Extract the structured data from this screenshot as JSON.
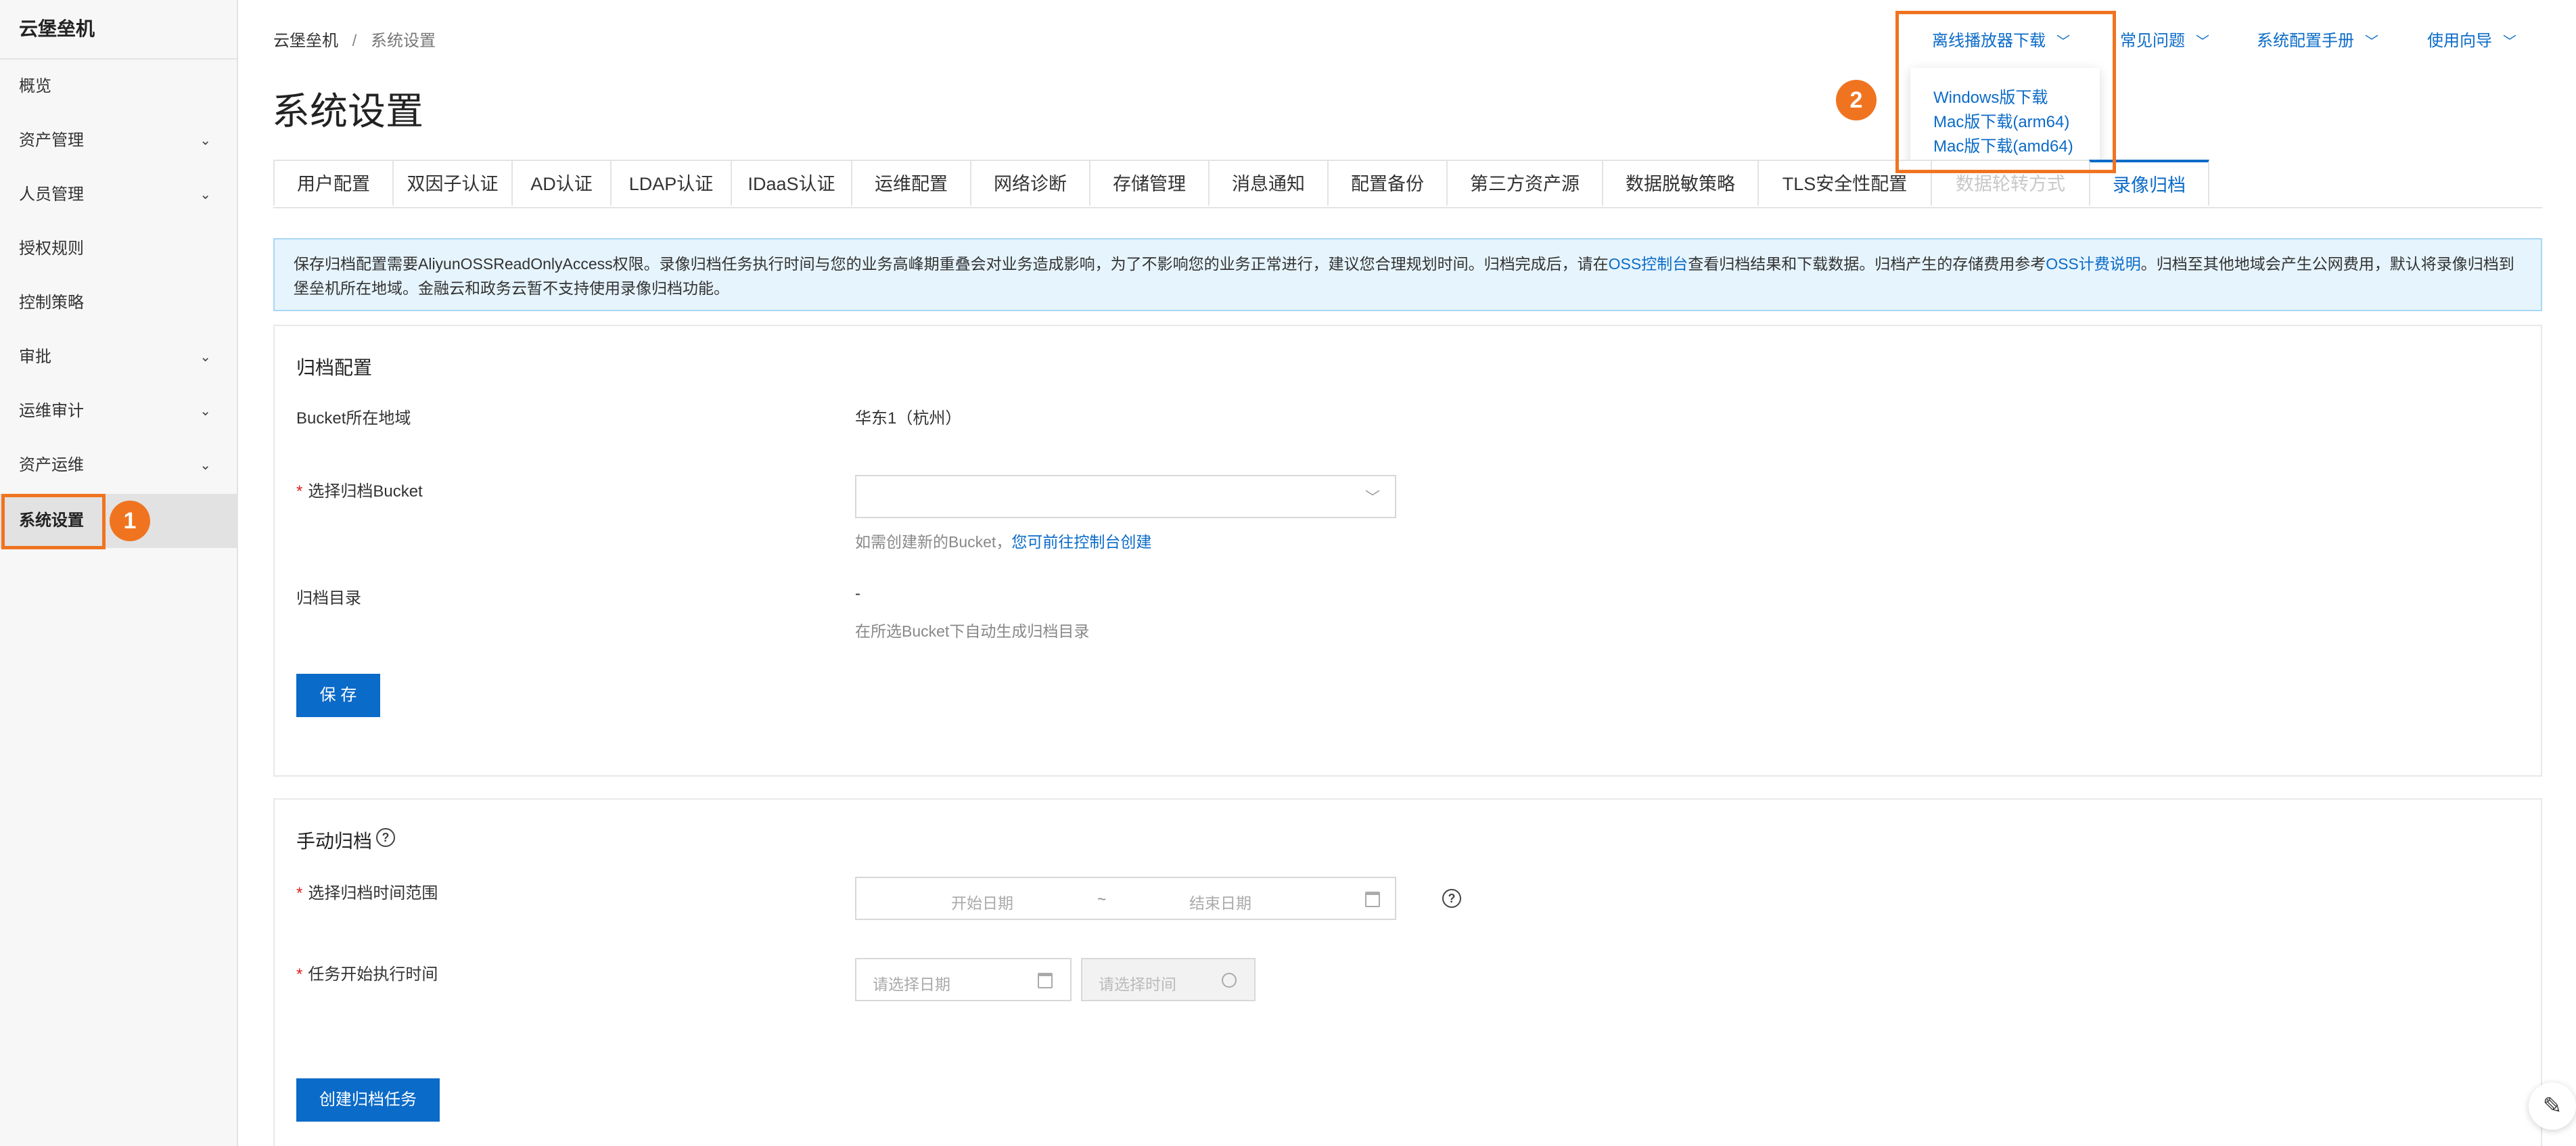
{
  "app": {
    "name": "云堡垒机"
  },
  "sidebar": {
    "items": [
      {
        "label": "概览",
        "has_children": false
      },
      {
        "label": "资产管理",
        "has_children": true
      },
      {
        "label": "人员管理",
        "has_children": true
      },
      {
        "label": "授权规则",
        "has_children": false
      },
      {
        "label": "控制策略",
        "has_children": false
      },
      {
        "label": "审批",
        "has_children": true
      },
      {
        "label": "运维审计",
        "has_children": true
      },
      {
        "label": "资产运维",
        "has_children": true
      },
      {
        "label": "系统设置",
        "has_children": false,
        "active": true
      }
    ]
  },
  "breadcrumb": {
    "root": "云堡垒机",
    "separator": "/",
    "current": "系统设置"
  },
  "page": {
    "title": "系统设置"
  },
  "top_links": {
    "player_download": "离线播放器下载",
    "faq": "常见问题",
    "manual": "系统配置手册",
    "guide": "使用向导"
  },
  "dropdown": {
    "items": [
      "Windows版下载",
      "Mac版下载(arm64)",
      "Mac版下载(amd64)"
    ]
  },
  "annotations": {
    "badge1": "1",
    "badge2": "2",
    "highlight_color": "#f07420"
  },
  "tabs": [
    {
      "label": "用户配置"
    },
    {
      "label": "双因子认证"
    },
    {
      "label": "AD认证"
    },
    {
      "label": "LDAP认证"
    },
    {
      "label": "IDaaS认证"
    },
    {
      "label": "运维配置"
    },
    {
      "label": "网络诊断"
    },
    {
      "label": "存储管理"
    },
    {
      "label": "消息通知"
    },
    {
      "label": "配置备份"
    },
    {
      "label": "第三方资产源"
    },
    {
      "label": "数据脱敏策略"
    },
    {
      "label": "TLS安全性配置"
    },
    {
      "label": "数据轮转方式",
      "disabled": true
    },
    {
      "label": "录像归档",
      "active": true
    }
  ],
  "notice": {
    "part1": "保存归档配置需要AliyunOSSReadOnlyAccess权限。录像归档任务执行时间与您的业务高峰期重叠会对业务造成影响，为了不影响您的业务正常进行，建议您合理规划时间。归档完成后，请在",
    "link1": "OSS控制台",
    "part2": "查看归档结果和下载数据。归档产生的存储费用参考",
    "link2": "OSS计费说明",
    "part3": "。归档至其他地域会产生公网费用，默认将录像归档到堡垒机所在地域。金融云和政务云暂不支持使用录像归档功能。"
  },
  "archive_config": {
    "title": "归档配置",
    "region_label": "Bucket所在地域",
    "region_value": "华东1（杭州）",
    "bucket_label": "选择归档Bucket",
    "bucket_value": "",
    "bucket_hint": "如需创建新的Bucket，",
    "bucket_hint_link": "您可前往控制台创建",
    "dir_label": "归档目录",
    "dir_value": "-",
    "dir_hint": "在所选Bucket下自动生成归档目录",
    "save_button": "保 存"
  },
  "manual_archive": {
    "title": "手动归档",
    "range_label": "选择归档时间范围",
    "start_placeholder": "开始日期",
    "range_sep": "~",
    "end_placeholder": "结束日期",
    "start_time_label": "任务开始执行时间",
    "date_placeholder": "请选择日期",
    "time_placeholder": "请选择时间",
    "create_button": "创建归档任务"
  },
  "required_mark": "*",
  "colors": {
    "primary": "#0b6bc8",
    "highlight": "#f07420",
    "notice_bg": "#e6f4fd"
  }
}
